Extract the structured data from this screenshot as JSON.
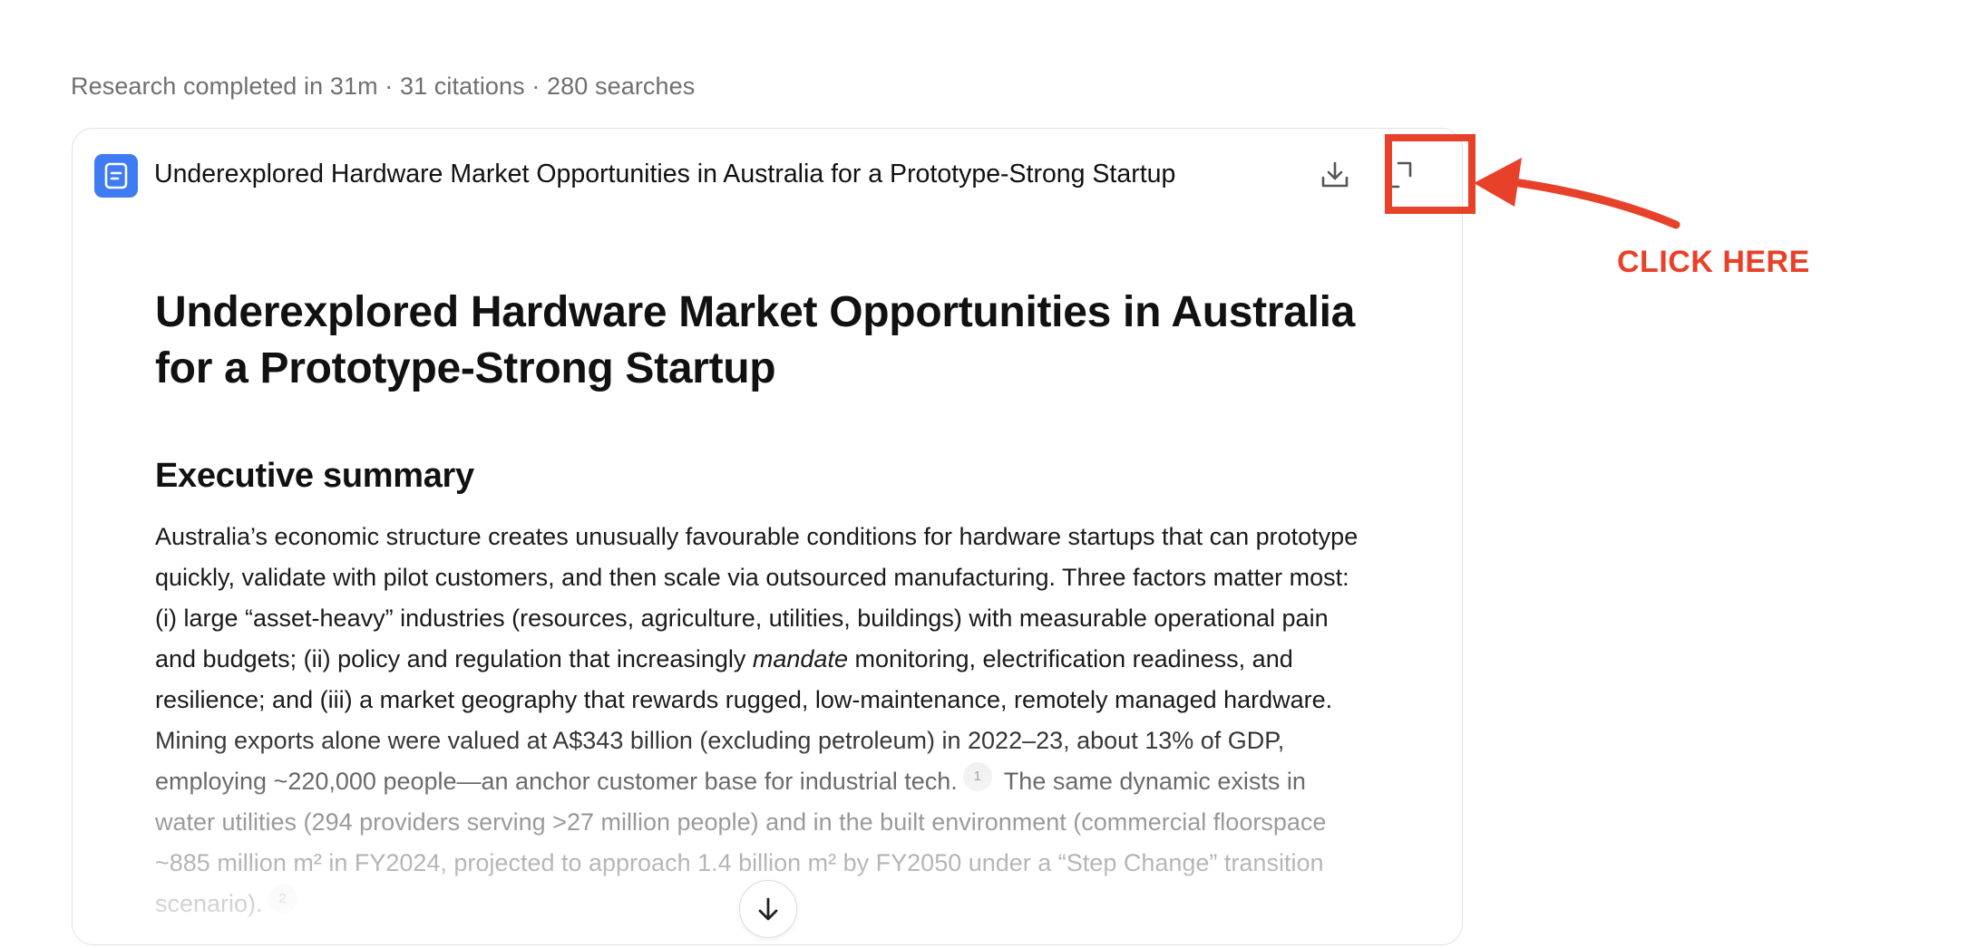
{
  "meta": {
    "summary_line": "Research completed in 31m · 31 citations · 280 searches"
  },
  "report": {
    "header_title": "Underexplored Hardware Market Opportunities in Australia for a Prototype-Strong Startup",
    "title": "Underexplored Hardware Market Opportunities in Australia for a Prototype-Strong Startup",
    "sections": [
      {
        "heading": "Executive summary",
        "p_part1": "Australia’s economic structure creates unusually favourable conditions for hardware startups that can prototype quickly, validate with pilot customers, and then scale via outsourced manufacturing. Three factors matter most: (i) large “asset-heavy” industries (resources, agriculture, utilities, buildings) with measurable operational pain and budgets; (ii) policy and regulation that increasingly ",
        "p_em": "mandate",
        "p_part2": " monitoring, electrification readiness, and resilience; and (iii) a market geography that rewards rugged, low-maintenance, remotely managed hardware. Mining exports alone were valued at A$343 billion (excluding petroleum) in 2022–23, about 13% of GDP, employing ~220,000 people—an anchor customer base for industrial tech.",
        "citation_1": "1",
        "p_part3": " The same dynamic exists in water utilities (294 providers serving >27 million people) and in the built environment (commercial floorspace ~885 million m² in FY2024, projected to approach 1.4 billion m² by FY2050 under a “Step Change” transition scenario).",
        "citation_2": "2"
      }
    ]
  },
  "toolbar": {
    "download_icon": "download-icon",
    "expand_icon": "expand-icon",
    "scroll_icon": "arrow-down-icon"
  },
  "annotation": {
    "label": "CLICK HERE",
    "color": "#e8412a"
  },
  "colors": {
    "doc_badge": "#3f7cf4"
  }
}
